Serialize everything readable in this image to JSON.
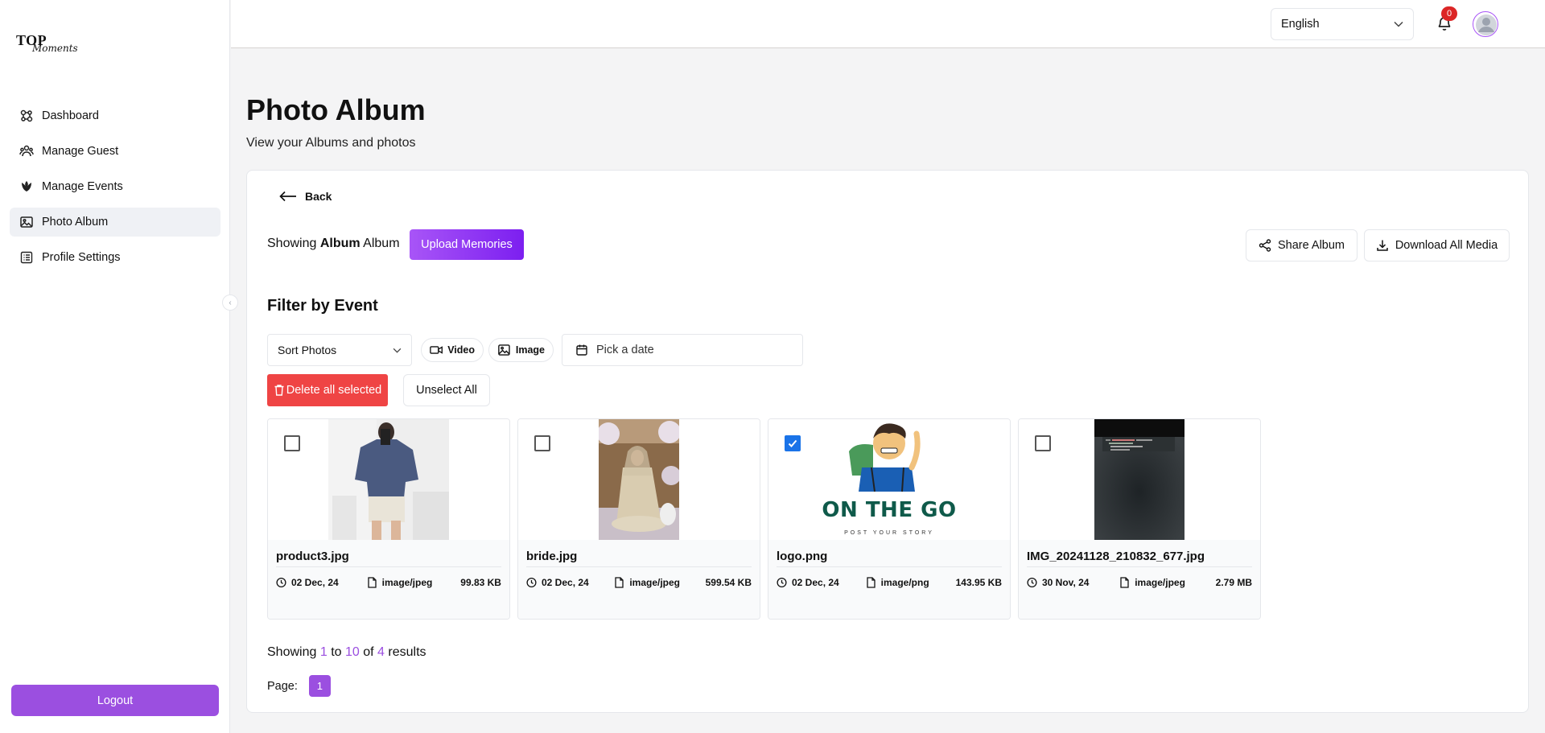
{
  "brand": {
    "top": "TOP",
    "moments": "Moments"
  },
  "sidebar": {
    "items": [
      {
        "label": "Dashboard",
        "icon": "dashboard-icon"
      },
      {
        "label": "Manage Guest",
        "icon": "users-icon"
      },
      {
        "label": "Manage Events",
        "icon": "tulip-icon"
      },
      {
        "label": "Photo Album",
        "icon": "image-icon",
        "active": true
      },
      {
        "label": "Profile Settings",
        "icon": "list-icon"
      }
    ],
    "logout_label": "Logout"
  },
  "header": {
    "language": "English",
    "notification_count": "0"
  },
  "page": {
    "title": "Photo Album",
    "subtitle": "View your Albums and photos"
  },
  "album": {
    "back_label": "Back",
    "showing_prefix": "Showing",
    "album_name": "Album",
    "showing_suffix": "Album",
    "upload_label": "Upload Memories",
    "share_label": "Share Album",
    "download_label": "Download All Media"
  },
  "filter": {
    "title": "Filter by Event",
    "sort_placeholder": "Sort Photos",
    "video_label": "Video",
    "image_label": "Image",
    "date_placeholder": "Pick a date",
    "delete_label": "Delete all selected",
    "unselect_label": "Unselect All"
  },
  "media": [
    {
      "name": "product3.jpg",
      "date": "02 Dec, 24",
      "type": "image/jpeg",
      "size": "99.83 KB",
      "checked": false
    },
    {
      "name": "bride.jpg",
      "date": "02 Dec, 24",
      "type": "image/jpeg",
      "size": "599.54 KB",
      "checked": false
    },
    {
      "name": "logo.png",
      "date": "02 Dec, 24",
      "type": "image/png",
      "size": "143.95 KB",
      "checked": true,
      "logo_text": "ON THE GO",
      "logo_sub": "POST YOUR STORY"
    },
    {
      "name": "IMG_20241128_210832_677.jpg",
      "date": "30 Nov, 24",
      "type": "image/jpeg",
      "size": "2.79 MB",
      "checked": false
    }
  ],
  "pagination": {
    "showing": "Showing",
    "from": "1",
    "to_word": "to",
    "to": "10",
    "of_word": "of",
    "total": "4",
    "results_word": "results",
    "page_label": "Page:",
    "current_page": "1"
  },
  "colors": {
    "accent": "#9b4fe0",
    "danger": "#ef4444",
    "checkbox": "#1a73e8"
  }
}
